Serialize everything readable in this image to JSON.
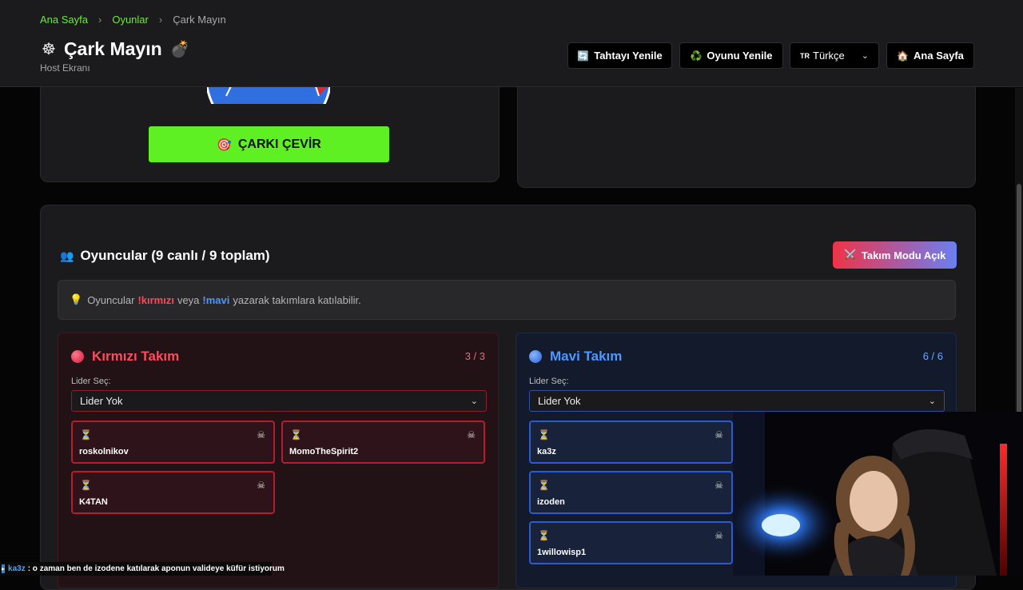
{
  "breadcrumb": {
    "home": "Ana Sayfa",
    "games": "Oyunlar",
    "current": "Çark Mayın"
  },
  "header": {
    "title_icon": "wheel-icon",
    "title": "Çark Mayın",
    "title_emoji": "💣",
    "subtitle": "Host Ekranı",
    "buttons": {
      "refresh_board": "Tahtayı Yenile",
      "restart_game": "Oyunu Yenile",
      "language": "Türkçe",
      "language_flag": "TR",
      "home": "Ana Sayfa"
    }
  },
  "wheel": {
    "spin_label": "ÇARKI ÇEVİR"
  },
  "players": {
    "title": "Oyuncular (9 canlı / 9 toplam)",
    "team_mode_label": "Takım Modu Açık",
    "info": {
      "prefix": "Oyuncular",
      "red_cmd": "!kırmızı",
      "middle": "veya",
      "blue_cmd": "!mavi",
      "suffix": "yazarak takımlara katılabilir."
    },
    "teams": {
      "red": {
        "name": "Kırmızı Takım",
        "count": "3 / 3",
        "leader_label": "Lider Seç:",
        "leader_value": "Lider Yok",
        "players": [
          "roskolnikov",
          "MomoTheSpirit2",
          "K4TAN"
        ]
      },
      "blue": {
        "name": "Mavi Takım",
        "count": "6 / 6",
        "leader_label": "Lider Seç:",
        "leader_value": "Lider Yok",
        "players": [
          "ka3z",
          "izoden",
          "1willowisp1"
        ]
      }
    }
  },
  "chat": {
    "user": "ka3z",
    "message": ": o zaman ben de izodene katılarak aponun valideye küfür istiyorum"
  },
  "colors": {
    "accent_green": "#5ef022",
    "red": "#ff4b5e",
    "blue": "#4e98ff"
  }
}
